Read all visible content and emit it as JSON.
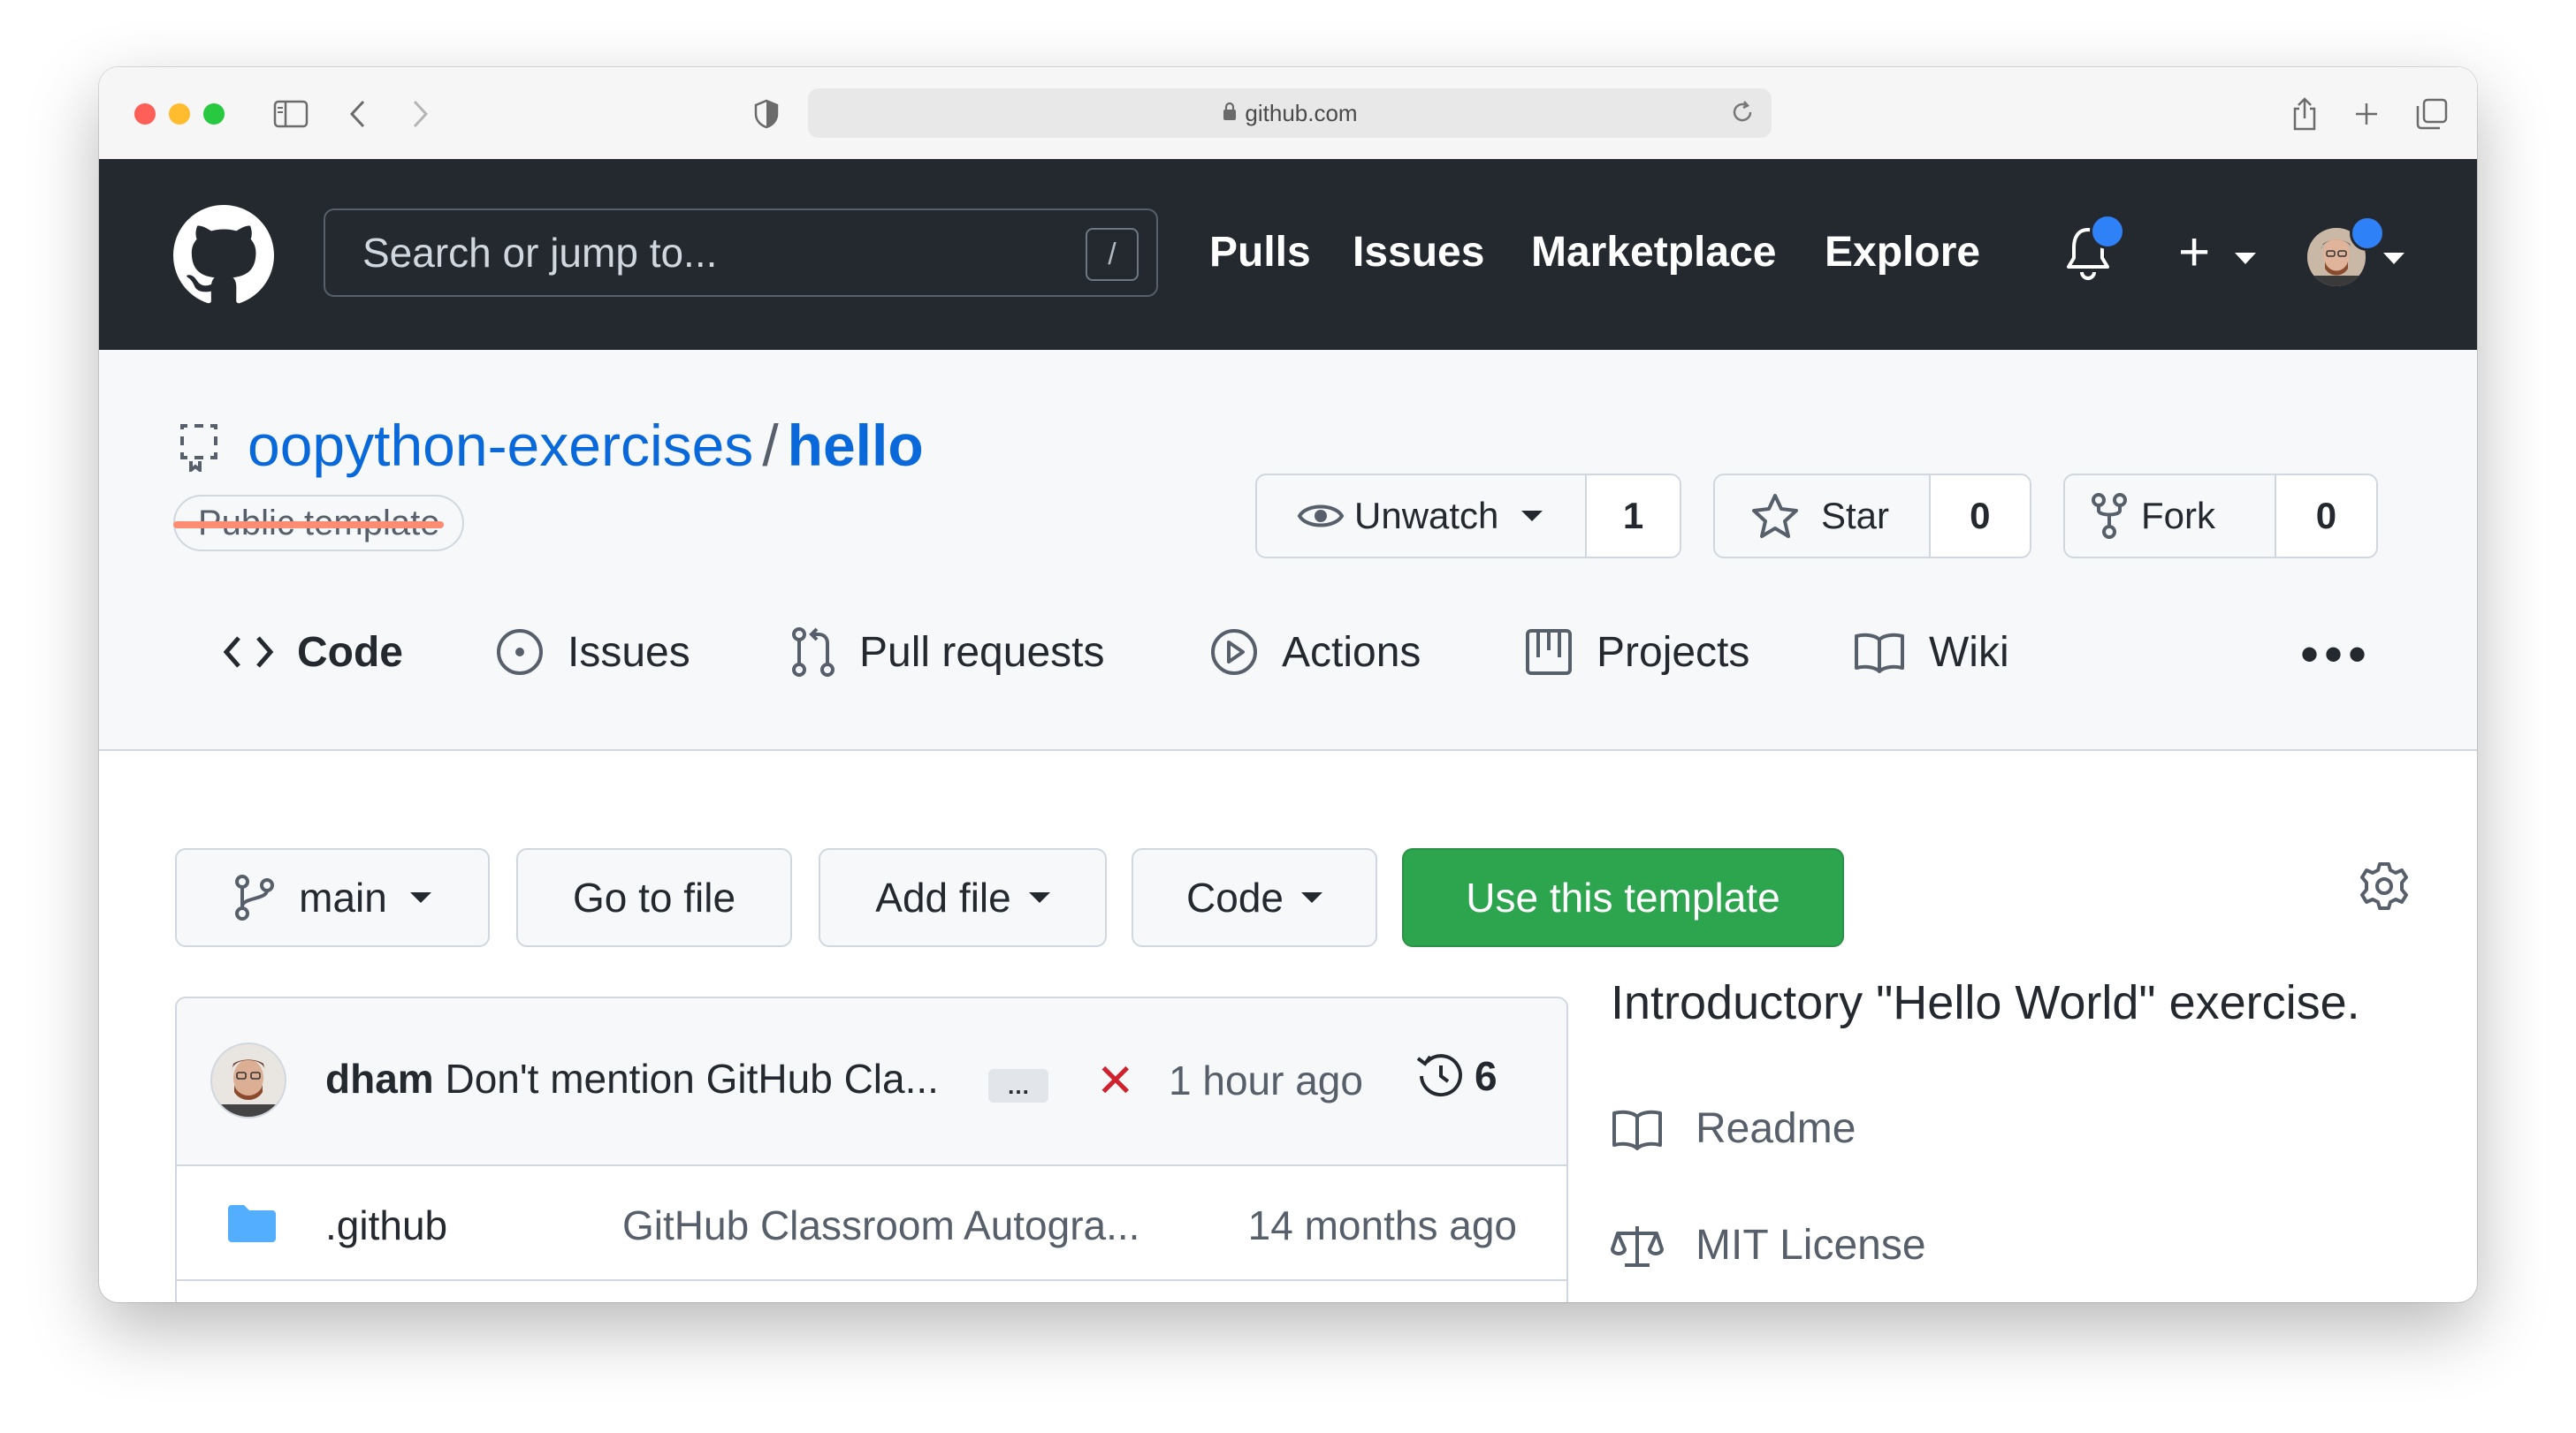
{
  "browser": {
    "url": "github.com"
  },
  "header": {
    "search_placeholder": "Search or jump to...",
    "search_shortcut": "/",
    "nav": [
      "Pulls",
      "Issues",
      "Marketplace",
      "Explore"
    ],
    "plus": "+"
  },
  "repo": {
    "owner": "oopython-exercises",
    "separator": "/",
    "name": "hello",
    "visibility_badge": "Public template",
    "watch": {
      "label": "Unwatch",
      "count": "1"
    },
    "star": {
      "label": "Star",
      "count": "0"
    },
    "fork": {
      "label": "Fork",
      "count": "0"
    }
  },
  "tabs": [
    {
      "label": "Code",
      "active": true
    },
    {
      "label": "Issues"
    },
    {
      "label": "Pull requests"
    },
    {
      "label": "Actions"
    },
    {
      "label": "Projects"
    },
    {
      "label": "Wiki"
    }
  ],
  "more": "•••",
  "actions": {
    "branch": "main",
    "go_to_file": "Go to file",
    "add_file": "Add file",
    "code": "Code",
    "use_template": "Use this template"
  },
  "commit": {
    "author": "dham",
    "message": "Don't mention GitHub Cla...",
    "ellipsis": "…",
    "status_mark": "✕",
    "time": "1 hour ago",
    "count": "6"
  },
  "files": [
    {
      "name": ".github",
      "message": "GitHub Classroom Autogra...",
      "time": "14 months ago"
    }
  ],
  "sidebar": {
    "description": "Introductory \"Hello World\" exercise.",
    "readme": "Readme",
    "license": "MIT License"
  },
  "colors": {
    "header_bg": "#24292f",
    "link_blue": "#0969da",
    "green_button": "#2da44e",
    "active_tab_underline": "#fd8c73",
    "notification_dot": "#2f81f7",
    "failure_red": "#cf222e"
  }
}
